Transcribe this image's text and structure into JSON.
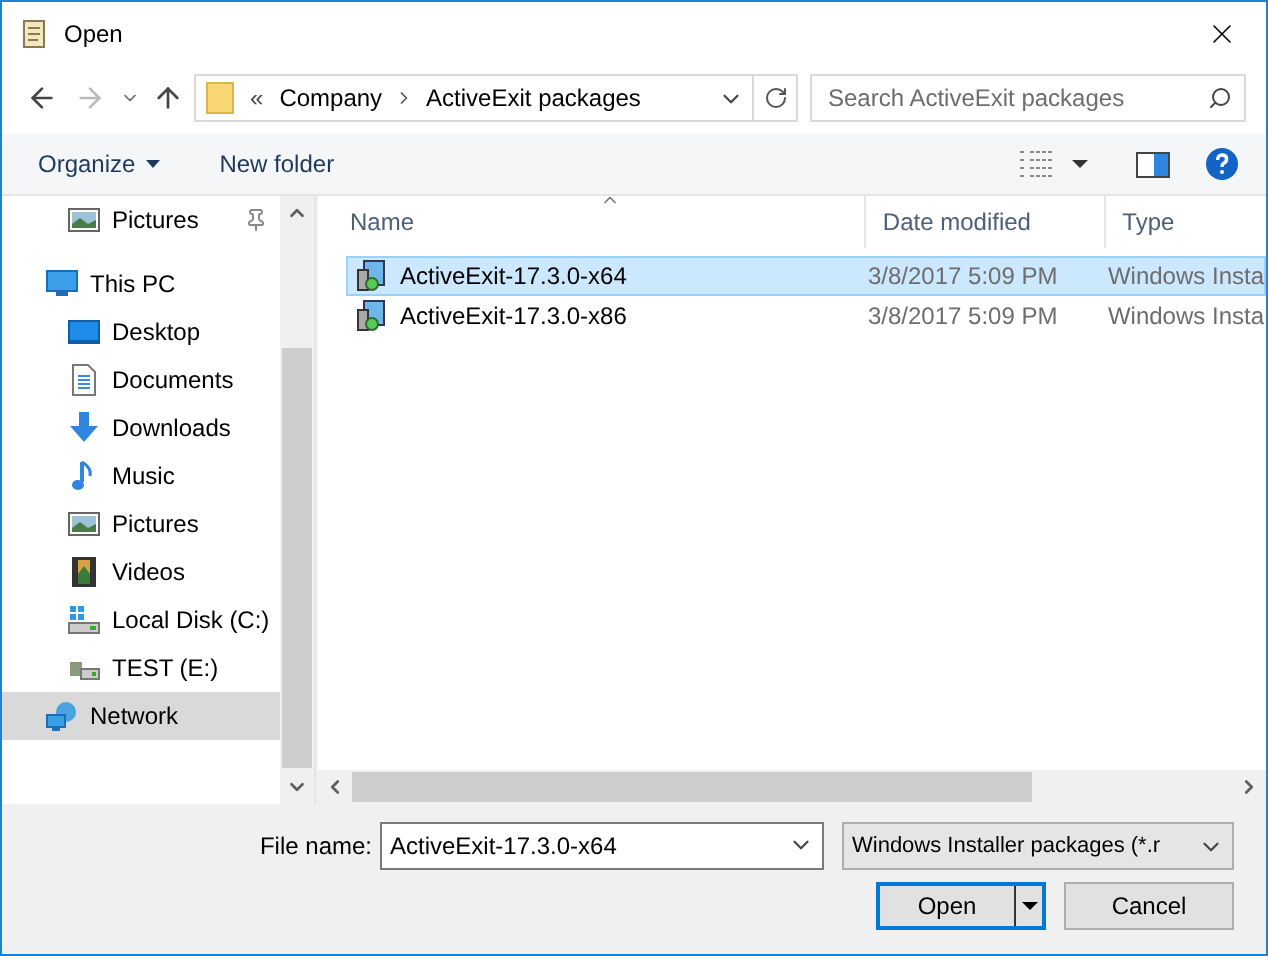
{
  "window": {
    "title": "Open"
  },
  "address": {
    "overflow": "«",
    "segments": [
      "Company",
      "ActiveExit packages"
    ]
  },
  "search": {
    "placeholder": "Search ActiveExit packages"
  },
  "toolbar": {
    "organize": "Organize",
    "new_folder": "New folder"
  },
  "sidebar": {
    "items": [
      {
        "label": "Pictures",
        "kind": "pictures",
        "pinned": true,
        "selected": false
      },
      {
        "label": "This PC",
        "kind": "pc",
        "pinned": false,
        "selected": false,
        "children": [
          {
            "label": "Desktop",
            "kind": "desktop",
            "pinned": false,
            "selected": false
          },
          {
            "label": "Documents",
            "kind": "documents",
            "pinned": false,
            "selected": false
          },
          {
            "label": "Downloads",
            "kind": "downloads",
            "pinned": false,
            "selected": false
          },
          {
            "label": "Music",
            "kind": "music",
            "pinned": false,
            "selected": false
          },
          {
            "label": "Pictures",
            "kind": "pictures",
            "pinned": false,
            "selected": false
          },
          {
            "label": "Videos",
            "kind": "videos",
            "pinned": false,
            "selected": false
          },
          {
            "label": "Local Disk (C:)",
            "kind": "disk",
            "pinned": false,
            "selected": false
          },
          {
            "label": "TEST (E:)",
            "kind": "netdrive",
            "pinned": false,
            "selected": false
          }
        ]
      },
      {
        "label": "Network",
        "kind": "network",
        "pinned": false,
        "selected": true
      }
    ]
  },
  "table": {
    "columns": [
      {
        "label": "Name",
        "sorted": true
      },
      {
        "label": "Date modified",
        "sorted": false
      },
      {
        "label": "Type",
        "sorted": false
      }
    ],
    "rows": [
      {
        "name": "ActiveExit-17.3.0-x64",
        "date": "3/8/2017 5:09 PM",
        "type": "Windows Insta",
        "selected": true
      },
      {
        "name": "ActiveExit-17.3.0-x86",
        "date": "3/8/2017 5:09 PM",
        "type": "Windows Insta",
        "selected": false
      }
    ]
  },
  "file_name": {
    "label": "File name:",
    "value": "ActiveExit-17.3.0-x64"
  },
  "filter": {
    "value": "Windows Installer packages (*.r"
  },
  "buttons": {
    "open": "Open",
    "cancel": "Cancel"
  }
}
